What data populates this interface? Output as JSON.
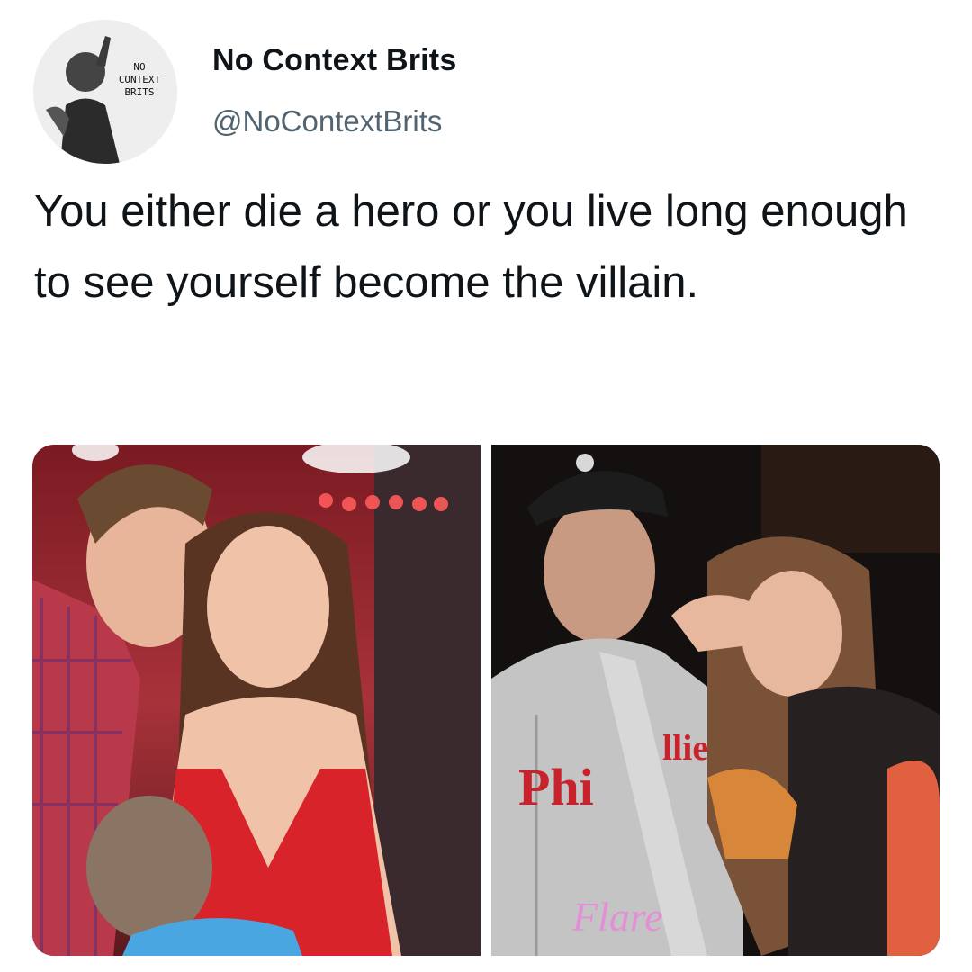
{
  "tweet": {
    "author": {
      "avatar_icon": "profile-avatar-icon",
      "avatar_text": [
        "NO",
        "CONTEXT",
        "BRITS"
      ],
      "display_name": "No Context Brits",
      "handle": "@NoContextBrits"
    },
    "text": "You either die a hero or you live long enough to see yourself become the villain.",
    "media": [
      {
        "description_icon": "photo-icon"
      },
      {
        "description_icon": "photo-icon",
        "shirt_text": "Phillies",
        "watermark_text": "Flare"
      }
    ]
  },
  "colors": {
    "text": "#0f1419",
    "secondary": "#536471",
    "background": "#ffffff"
  }
}
